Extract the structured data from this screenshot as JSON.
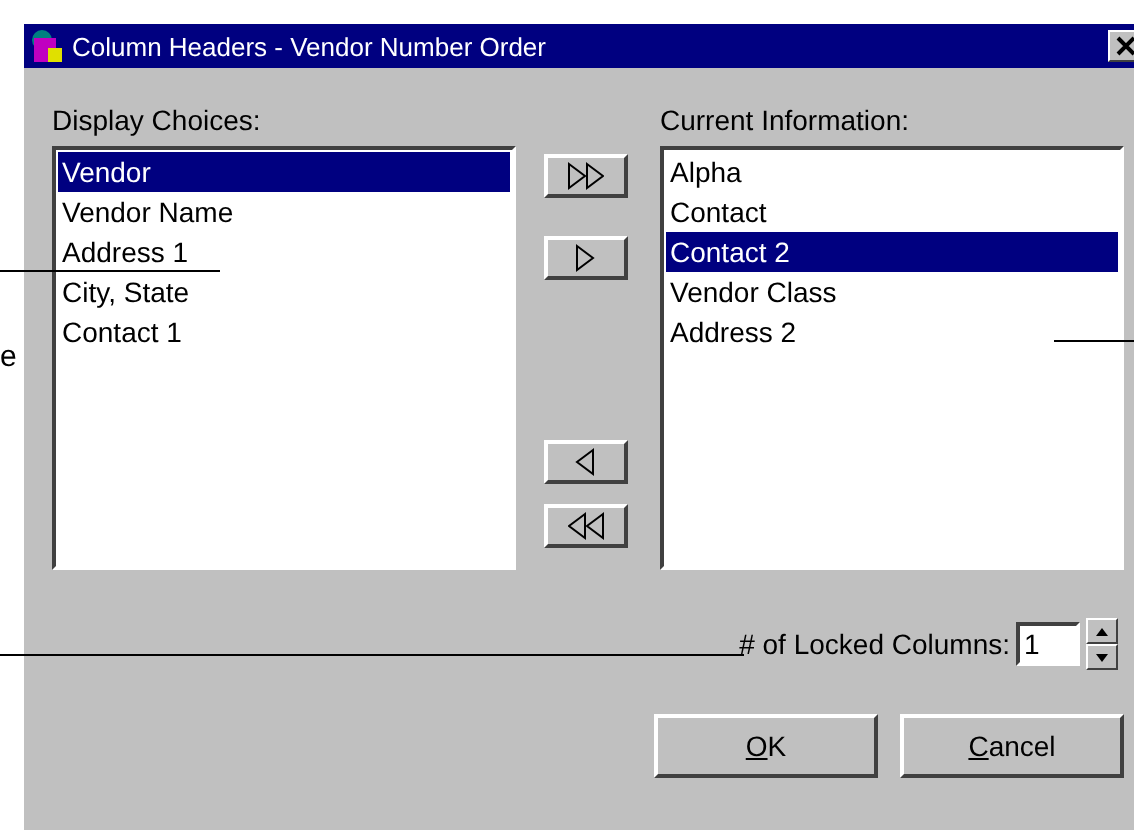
{
  "window": {
    "title": "Column Headers - Vendor Number Order"
  },
  "annotation_fragment": "e",
  "display_choices": {
    "label": "Display Choices:",
    "items": [
      {
        "text": "Vendor",
        "selected": true
      },
      {
        "text": "Vendor Name",
        "selected": false
      },
      {
        "text": "Address 1",
        "selected": false
      },
      {
        "text": "City, State",
        "selected": false
      },
      {
        "text": "Contact 1",
        "selected": false
      }
    ]
  },
  "move_buttons": [
    {
      "kind": "add_all"
    },
    {
      "kind": "add"
    },
    {
      "kind": "remove"
    },
    {
      "kind": "remove_all"
    }
  ],
  "current_information": {
    "label": "Current Information:",
    "items": [
      {
        "text": "Alpha",
        "selected": false
      },
      {
        "text": "Contact",
        "selected": false
      },
      {
        "text": "Contact 2",
        "selected": true
      },
      {
        "text": "Vendor Class",
        "selected": false
      },
      {
        "text": "Address 2",
        "selected": false
      }
    ]
  },
  "locked_columns": {
    "label": "# of Locked Columns:",
    "value": "1"
  },
  "buttons": [
    "OK",
    "Cancel"
  ]
}
